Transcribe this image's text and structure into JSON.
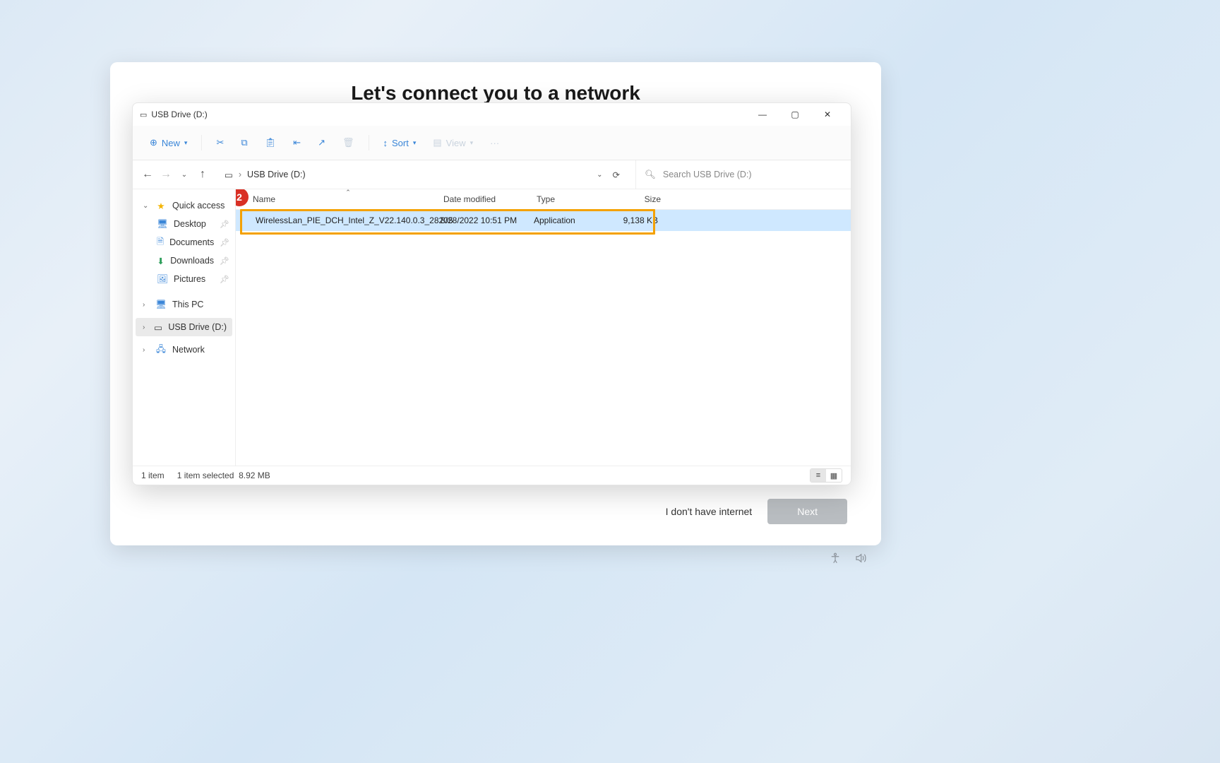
{
  "oobe": {
    "heading": "Let's connect you to a network",
    "no_internet": "I don't have internet",
    "next": "Next"
  },
  "explorer": {
    "title": "USB Drive (D:)",
    "toolbar": {
      "new": "New",
      "cut": "",
      "copy": "",
      "paste": "",
      "rename": "",
      "share": "",
      "delete": "",
      "sort": "Sort",
      "view": "View",
      "more": "···"
    },
    "address": {
      "root_icon": "▭",
      "segments": [
        "USB Drive (D:)"
      ],
      "search_placeholder": "Search USB Drive (D:)"
    },
    "sidebar": {
      "quick_access": "Quick access",
      "desktop": "Desktop",
      "documents": "Documents",
      "downloads": "Downloads",
      "pictures": "Pictures",
      "this_pc": "This PC",
      "usb_drive": "USB Drive (D:)",
      "network": "Network"
    },
    "columns": {
      "name": "Name",
      "date": "Date modified",
      "type": "Type",
      "size": "Size"
    },
    "files": [
      {
        "name": "WirelessLan_PIE_DCH_Intel_Z_V22.140.0.3_28205",
        "date": "8/28/2022 10:51 PM",
        "type": "Application",
        "size": "9,138 KB"
      }
    ],
    "status": {
      "count": "1 item",
      "selected": "1 item selected",
      "size": "8.92 MB"
    },
    "annotation": {
      "step": "2"
    }
  }
}
